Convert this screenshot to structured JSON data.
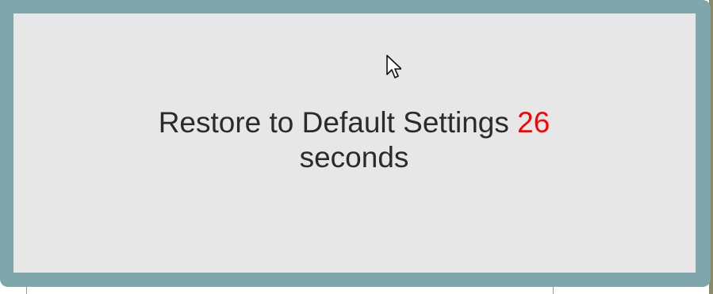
{
  "dialog": {
    "message_prefix": "Restore to Default Settings",
    "countdown_value": "26",
    "message_suffix": "seconds",
    "countdown_color": "#ff0000",
    "frame_color": "#7ea6ab",
    "body_color": "#e7e7e7"
  },
  "cursor": {
    "icon": "mouse-pointer-icon"
  }
}
